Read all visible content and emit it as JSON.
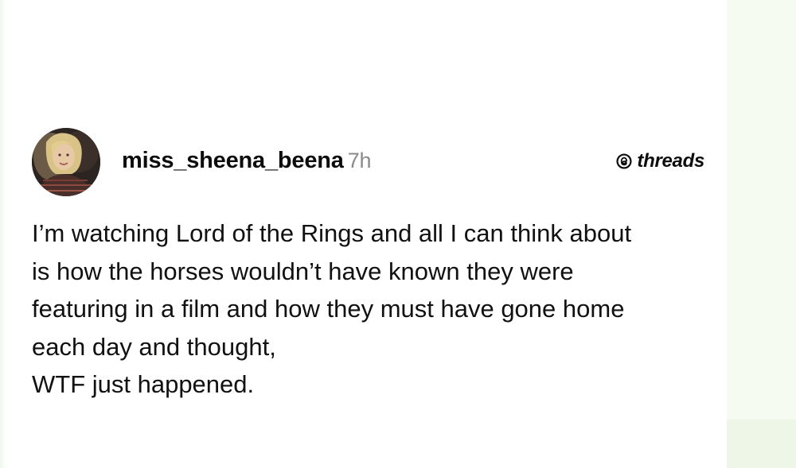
{
  "post": {
    "username": "miss_sheena_beena",
    "timestamp": "7h",
    "brand": "threads",
    "brand_icon": "threads-logo-icon",
    "text_lines": [
      "I’m watching Lord of the Rings and all I can think about",
      "is how the horses wouldn’t have known they were",
      "featuring in a film and how they must have gone home",
      "each day and thought,",
      "WTF just happened."
    ]
  },
  "colors": {
    "background": "#ffffff",
    "text": "#111111",
    "timestamp": "#8a8a8a",
    "right_panel": "#f6fbf2"
  }
}
